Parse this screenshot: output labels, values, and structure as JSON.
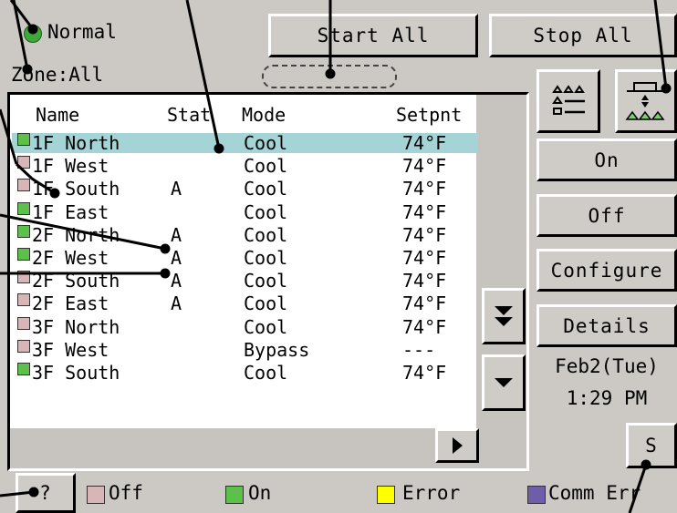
{
  "status": {
    "label": "Normal",
    "led_color": "#3fa83a"
  },
  "zone_label": "Zone:All",
  "toolbar": {
    "start_all": "Start All",
    "stop_all": "Stop All"
  },
  "list": {
    "headers": {
      "name": "Name",
      "stat": "Stat",
      "mode": "Mode",
      "setpnt": "Setpnt"
    },
    "rows": [
      {
        "name": "1F North",
        "stat": "",
        "mode": "Cool",
        "setpnt": "74°F",
        "state": "on",
        "selected": true
      },
      {
        "name": "1F West",
        "stat": "",
        "mode": "Cool",
        "setpnt": "74°F",
        "state": "off",
        "selected": false
      },
      {
        "name": "1F South",
        "stat": "A",
        "mode": "Cool",
        "setpnt": "74°F",
        "state": "off",
        "selected": false
      },
      {
        "name": "1F East",
        "stat": "",
        "mode": "Cool",
        "setpnt": "74°F",
        "state": "on",
        "selected": false
      },
      {
        "name": "2F North",
        "stat": "A",
        "mode": "Cool",
        "setpnt": "74°F",
        "state": "on",
        "selected": false
      },
      {
        "name": "2F West",
        "stat": "A",
        "mode": "Cool",
        "setpnt": "74°F",
        "state": "on",
        "selected": false
      },
      {
        "name": "2F South",
        "stat": "A",
        "mode": "Cool",
        "setpnt": "74°F",
        "state": "off",
        "selected": false
      },
      {
        "name": "2F East",
        "stat": "A",
        "mode": "Cool",
        "setpnt": "74°F",
        "state": "off",
        "selected": false
      },
      {
        "name": "3F North",
        "stat": "",
        "mode": "Cool",
        "setpnt": "74°F",
        "state": "off",
        "selected": false
      },
      {
        "name": "3F West",
        "stat": "",
        "mode": "Bypass",
        "setpnt": "---",
        "state": "off",
        "selected": false
      },
      {
        "name": "3F South",
        "stat": "",
        "mode": "Cool",
        "setpnt": "74°F",
        "state": "on",
        "selected": false
      }
    ]
  },
  "side": {
    "on": "On",
    "off": "Off",
    "configure": "Configure",
    "details": "Details",
    "date": "Feb2(Tue)",
    "time": "1:29 PM",
    "s_button": "S"
  },
  "legend": {
    "help": "?",
    "items": [
      {
        "label": "Off",
        "color": "#d8b6b8"
      },
      {
        "label": "On",
        "color": "#5cc04a"
      },
      {
        "label": "Error",
        "color": "#ffff00"
      },
      {
        "label": "Comm Err",
        "color": "#6e5eaa"
      }
    ]
  },
  "colors": {
    "on": "#5cc04a",
    "off": "#d8b6b8",
    "selected_row": "#a4d4d6"
  }
}
